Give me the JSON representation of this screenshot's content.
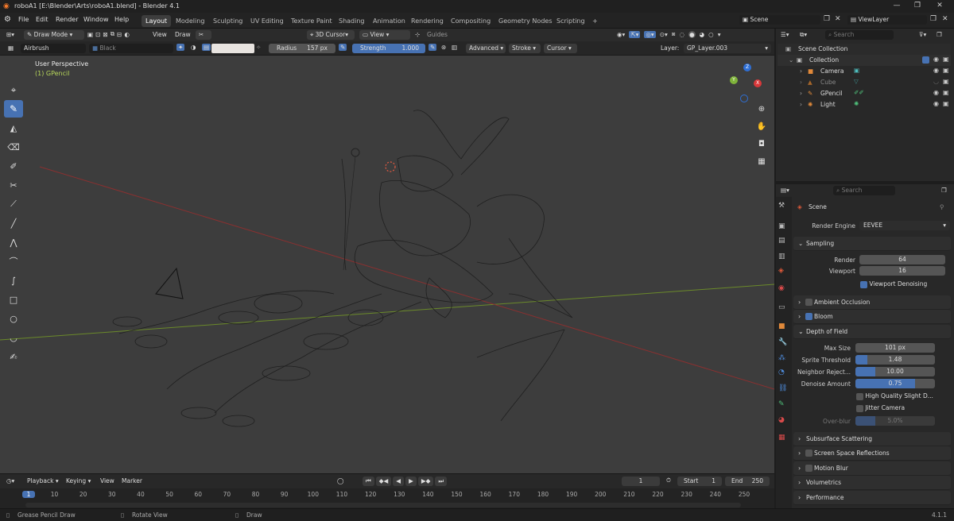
{
  "window": {
    "title": "roboA1 [E:\\Blender\\Arts\\roboA1.blend] - Blender 4.1",
    "minimize": "—",
    "maximize": "❐",
    "close": "✕"
  },
  "menus": [
    "File",
    "Edit",
    "Render",
    "Window",
    "Help"
  ],
  "workspaces": [
    "Layout",
    "Modeling",
    "Sculpting",
    "UV Editing",
    "Texture Paint",
    "Shading",
    "Animation",
    "Rendering",
    "Compositing",
    "Geometry Nodes",
    "Scripting",
    "+"
  ],
  "scene_selector": {
    "scene": "Scene",
    "view_layer": "ViewLayer"
  },
  "header": {
    "mode": "Draw Mode",
    "view": "View",
    "draw": "Draw",
    "cursor": "3D Cursor",
    "view2": "View",
    "guides": "Guides"
  },
  "tool_settings": {
    "brush": "Airbrush",
    "material": "Black",
    "radius_label": "Radius",
    "radius_value": "157 px",
    "strength_label": "Strength",
    "strength_value": "1.000",
    "advanced": "Advanced",
    "stroke": "Stroke",
    "cursor": "Cursor",
    "layer_label": "Layer:",
    "layer_value": "GP_Layer.003",
    "strength_fill": 1.0
  },
  "viewport": {
    "perspective": "User Perspective",
    "object": "(1) GPencil",
    "axis_x": "X",
    "axis_y": "Y",
    "axis_z": "Z"
  },
  "outliner": {
    "search_placeholder": "Search",
    "items": [
      {
        "label": "Scene Collection",
        "depth": 0
      },
      {
        "label": "Collection",
        "depth": 1
      },
      {
        "label": "Camera",
        "depth": 2
      },
      {
        "label": "Cube",
        "depth": 2
      },
      {
        "label": "GPencil",
        "depth": 2
      },
      {
        "label": "Light",
        "depth": 2
      }
    ]
  },
  "properties": {
    "search_placeholder": "Search",
    "context": "Scene",
    "render_engine_label": "Render Engine",
    "render_engine": "EEVEE",
    "sampling": {
      "title": "Sampling",
      "render_label": "Render",
      "render": "64",
      "viewport_label": "Viewport",
      "viewport": "16",
      "denoise": "Viewport Denoising"
    },
    "ambient_occlusion": "Ambient Occlusion",
    "bloom": "Bloom",
    "dof": {
      "title": "Depth of Field",
      "max_size_label": "Max Size",
      "max_size": "101 px",
      "sprite_label": "Sprite Threshold",
      "sprite": "1.48",
      "sprite_fill": 0.15,
      "neighbor_label": "Neighbor Reject...",
      "neighbor": "10.00",
      "neighbor_fill": 0.25,
      "denoise_label": "Denoise Amount",
      "denoise": "0.75",
      "denoise_fill": 0.75,
      "hq": "High Quality Slight D...",
      "jitter": "Jitter Camera",
      "overblur_label": "Over-blur",
      "overblur": "5.0%",
      "overblur_fill": 0.25
    },
    "subsurface": "Subsurface Scattering",
    "ssr": "Screen Space Reflections",
    "motion_blur": "Motion Blur",
    "volumetrics": "Volumetrics",
    "performance": "Performance"
  },
  "timeline": {
    "playback": "Playback",
    "keying": "Keying",
    "view": "View",
    "marker": "Marker",
    "current_frame": "1",
    "start_label": "Start",
    "start": "1",
    "end_label": "End",
    "end": "250",
    "ticks": [
      "1",
      "10",
      "20",
      "30",
      "40",
      "50",
      "60",
      "70",
      "80",
      "90",
      "100",
      "110",
      "120",
      "130",
      "140",
      "150",
      "160",
      "170",
      "180",
      "190",
      "200",
      "210",
      "220",
      "230",
      "240",
      "250"
    ]
  },
  "status": {
    "left": "Grease Pencil Draw",
    "middle": "Rotate View",
    "right": "Draw",
    "version": "4.1.1"
  }
}
